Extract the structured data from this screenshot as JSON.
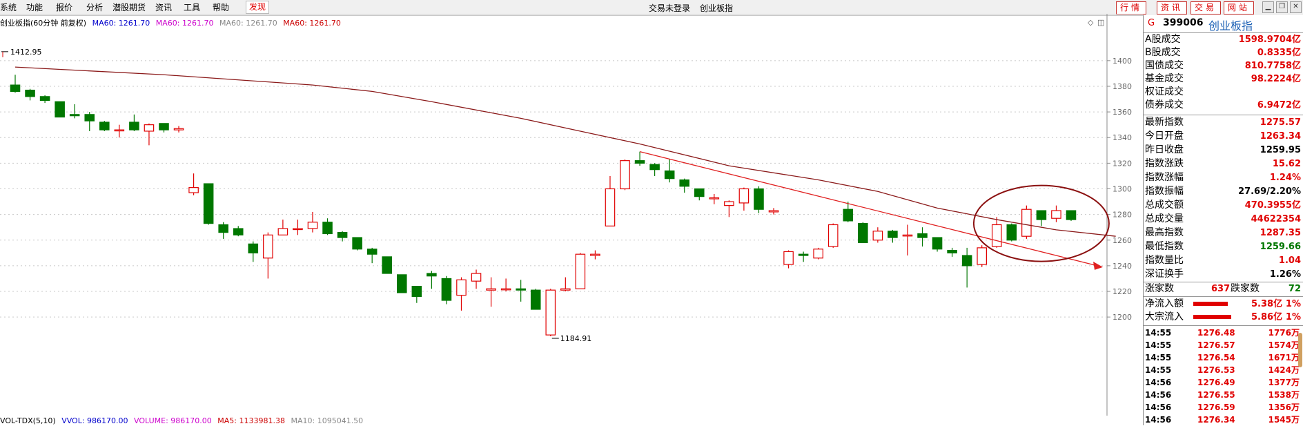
{
  "menu": {
    "items": [
      "系统",
      "功能",
      "报价",
      "分析",
      "潜股期货",
      "资讯",
      "工具",
      "帮助"
    ],
    "active": "发现",
    "center_login": "交易未登录",
    "center_index": "创业板指",
    "right_buttons": [
      "行情",
      "资讯",
      "交易",
      "网站"
    ]
  },
  "chart_header": {
    "title": "创业板指(60分钟 前复权)",
    "ma_labels": [
      "MA60: 1261.70",
      "MA60: 1261.70",
      "MA60: 1261.70",
      "MA60: 1261.70"
    ],
    "ma_colors": [
      "#0000cc",
      "#cc00cc",
      "#888888",
      "#cc0000"
    ]
  },
  "vol_header": {
    "items": [
      "VOL-TDX(5,10)",
      "VVOL: 986170.00",
      "VOLUME: 986170.00",
      "MA5: 1133981.38",
      "MA10: 1095041.50"
    ],
    "colors": [
      "#000000",
      "#0000cc",
      "#cc00cc",
      "#cc0000",
      "#888888"
    ]
  },
  "chart_data": {
    "type": "candlestick",
    "ylim": [
      1185,
      1415
    ],
    "y_ticks": [
      1200,
      1220,
      1240,
      1260,
      1280,
      1300,
      1320,
      1340,
      1360,
      1380,
      1400
    ],
    "high_label": "1412.95",
    "low_label": "1184.91",
    "up_color": "#e00000",
    "down_color": "#007700",
    "ma_color": "#8b1a1a",
    "candles": [
      {
        "o": 1381,
        "c": 1376,
        "h": 1389,
        "l": 1375
      },
      {
        "o": 1377,
        "c": 1372,
        "h": 1378,
        "l": 1369
      },
      {
        "o": 1372,
        "c": 1369,
        "h": 1373,
        "l": 1367
      },
      {
        "o": 1368,
        "c": 1356,
        "h": 1368,
        "l": 1356
      },
      {
        "o": 1358,
        "c": 1357,
        "h": 1366,
        "l": 1355
      },
      {
        "o": 1358,
        "c": 1353,
        "h": 1360,
        "l": 1345
      },
      {
        "o": 1352,
        "c": 1346,
        "h": 1353,
        "l": 1345
      },
      {
        "o": 1346,
        "c": 1346,
        "h": 1350,
        "l": 1340
      },
      {
        "o": 1352,
        "c": 1346,
        "h": 1358,
        "l": 1345
      },
      {
        "o": 1345,
        "c": 1350,
        "h": 1351,
        "l": 1334
      },
      {
        "o": 1351,
        "c": 1346,
        "h": 1351,
        "l": 1344
      },
      {
        "o": 1346,
        "c": 1347,
        "h": 1349,
        "l": 1344
      },
      {
        "o": 1297,
        "c": 1301,
        "h": 1312,
        "l": 1295
      },
      {
        "o": 1304,
        "c": 1273,
        "h": 1304,
        "l": 1272
      },
      {
        "o": 1272,
        "c": 1266,
        "h": 1274,
        "l": 1261
      },
      {
        "o": 1269,
        "c": 1264,
        "h": 1271,
        "l": 1263
      },
      {
        "o": 1257,
        "c": 1250,
        "h": 1259,
        "l": 1243
      },
      {
        "o": 1246,
        "c": 1264,
        "h": 1266,
        "l": 1230
      },
      {
        "o": 1264,
        "c": 1269,
        "h": 1276,
        "l": 1264
      },
      {
        "o": 1269,
        "c": 1269,
        "h": 1276,
        "l": 1264
      },
      {
        "o": 1269,
        "c": 1274,
        "h": 1282,
        "l": 1266
      },
      {
        "o": 1274,
        "c": 1265,
        "h": 1277,
        "l": 1264
      },
      {
        "o": 1266,
        "c": 1262,
        "h": 1267,
        "l": 1259
      },
      {
        "o": 1262,
        "c": 1253,
        "h": 1262,
        "l": 1252
      },
      {
        "o": 1253,
        "c": 1249,
        "h": 1254,
        "l": 1242
      },
      {
        "o": 1247,
        "c": 1234,
        "h": 1247,
        "l": 1234
      },
      {
        "o": 1233,
        "c": 1219,
        "h": 1233,
        "l": 1219
      },
      {
        "o": 1224,
        "c": 1216,
        "h": 1224,
        "l": 1211
      },
      {
        "o": 1234,
        "c": 1232,
        "h": 1236,
        "l": 1222
      },
      {
        "o": 1230,
        "c": 1213,
        "h": 1232,
        "l": 1210
      },
      {
        "o": 1217,
        "c": 1229,
        "h": 1231,
        "l": 1205
      },
      {
        "o": 1228,
        "c": 1234,
        "h": 1237,
        "l": 1222
      },
      {
        "o": 1221,
        "c": 1222,
        "h": 1231,
        "l": 1208
      },
      {
        "o": 1222,
        "c": 1222,
        "h": 1230,
        "l": 1220
      },
      {
        "o": 1222,
        "c": 1221,
        "h": 1229,
        "l": 1212
      },
      {
        "o": 1221,
        "c": 1206,
        "h": 1222,
        "l": 1206
      },
      {
        "o": 1186,
        "c": 1221,
        "h": 1222,
        "l": 1185
      },
      {
        "o": 1221,
        "c": 1222,
        "h": 1231,
        "l": 1220
      },
      {
        "o": 1222,
        "c": 1249,
        "h": 1250,
        "l": 1222
      },
      {
        "o": 1248,
        "c": 1249,
        "h": 1252,
        "l": 1245
      },
      {
        "o": 1271,
        "c": 1300,
        "h": 1310,
        "l": 1271
      },
      {
        "o": 1300,
        "c": 1322,
        "h": 1323,
        "l": 1299
      },
      {
        "o": 1322,
        "c": 1320,
        "h": 1329,
        "l": 1318
      },
      {
        "o": 1319,
        "c": 1315,
        "h": 1320,
        "l": 1310
      },
      {
        "o": 1314,
        "c": 1308,
        "h": 1323,
        "l": 1305
      },
      {
        "o": 1307,
        "c": 1302,
        "h": 1308,
        "l": 1297
      },
      {
        "o": 1300,
        "c": 1294,
        "h": 1300,
        "l": 1291
      },
      {
        "o": 1293,
        "c": 1293,
        "h": 1296,
        "l": 1288
      },
      {
        "o": 1287,
        "c": 1290,
        "h": 1291,
        "l": 1278
      },
      {
        "o": 1289,
        "c": 1300,
        "h": 1301,
        "l": 1283
      },
      {
        "o": 1300,
        "c": 1284,
        "h": 1302,
        "l": 1281
      },
      {
        "o": 1282,
        "c": 1283,
        "h": 1285,
        "l": 1280
      },
      {
        "o": 1241,
        "c": 1251,
        "h": 1252,
        "l": 1238
      },
      {
        "o": 1249,
        "c": 1248,
        "h": 1251,
        "l": 1243
      },
      {
        "o": 1246,
        "c": 1253,
        "h": 1254,
        "l": 1245
      },
      {
        "o": 1255,
        "c": 1272,
        "h": 1273,
        "l": 1254
      },
      {
        "o": 1284,
        "c": 1275,
        "h": 1290,
        "l": 1274
      },
      {
        "o": 1273,
        "c": 1258,
        "h": 1274,
        "l": 1258
      },
      {
        "o": 1260,
        "c": 1267,
        "h": 1270,
        "l": 1258
      },
      {
        "o": 1267,
        "c": 1262,
        "h": 1268,
        "l": 1258
      },
      {
        "o": 1264,
        "c": 1264,
        "h": 1272,
        "l": 1248
      },
      {
        "o": 1265,
        "c": 1262,
        "h": 1270,
        "l": 1255
      },
      {
        "o": 1262,
        "c": 1253,
        "h": 1262,
        "l": 1251
      },
      {
        "o": 1252,
        "c": 1250,
        "h": 1254,
        "l": 1247
      },
      {
        "o": 1248,
        "c": 1240,
        "h": 1254,
        "l": 1223
      },
      {
        "o": 1241,
        "c": 1254,
        "h": 1256,
        "l": 1239
      },
      {
        "o": 1255,
        "c": 1272,
        "h": 1278,
        "l": 1254
      },
      {
        "o": 1272,
        "c": 1260,
        "h": 1273,
        "l": 1259
      },
      {
        "o": 1263,
        "c": 1284,
        "h": 1287,
        "l": 1261
      },
      {
        "o": 1283,
        "c": 1276,
        "h": 1283,
        "l": 1271
      },
      {
        "o": 1277,
        "c": 1283,
        "h": 1287,
        "l": 1274
      },
      {
        "o": 1283,
        "c": 1276,
        "h": 1283,
        "l": 1275
      }
    ],
    "ma_line": [
      [
        0,
        1395
      ],
      [
        10,
        1389
      ],
      [
        20,
        1381
      ],
      [
        24,
        1376
      ],
      [
        28,
        1368
      ],
      [
        34,
        1355
      ],
      [
        38,
        1345
      ],
      [
        42,
        1335
      ],
      [
        48,
        1318
      ],
      [
        54,
        1307
      ],
      [
        58,
        1298
      ],
      [
        62,
        1285
      ],
      [
        66,
        1276
      ],
      [
        70,
        1268
      ],
      [
        74,
        1263
      ]
    ]
  },
  "right_panel": {
    "header_code": "399006",
    "header_name": "创业板指",
    "header_mark": "G",
    "rows_a": [
      {
        "label": "A股成交",
        "value": "1598.9704亿",
        "color": "#e00000"
      },
      {
        "label": "B股成交",
        "value": "0.8335亿",
        "color": "#e00000"
      },
      {
        "label": "国债成交",
        "value": "810.7758亿",
        "color": "#e00000"
      },
      {
        "label": "基金成交",
        "value": "98.2224亿",
        "color": "#e00000"
      },
      {
        "label": "权证成交",
        "value": "",
        "color": "#e00000"
      },
      {
        "label": "债券成交",
        "value": "6.9472亿",
        "color": "#e00000"
      }
    ],
    "rows_b": [
      {
        "label": "最新指数",
        "value": "1275.57",
        "color": "#e00000"
      },
      {
        "label": "今日开盘",
        "value": "1263.34",
        "color": "#e00000"
      },
      {
        "label": "昨日收盘",
        "value": "1259.95",
        "color": "#000000"
      },
      {
        "label": "指数涨跌",
        "value": "15.62",
        "color": "#e00000"
      },
      {
        "label": "指数涨幅",
        "value": "1.24%",
        "color": "#e00000"
      },
      {
        "label": "指数振幅",
        "value": "27.69/2.20%",
        "color": "#000000"
      },
      {
        "label": "总成交额",
        "value": "470.3955亿",
        "color": "#e00000"
      },
      {
        "label": "总成交量",
        "value": "44622354",
        "color": "#e00000"
      },
      {
        "label": "最高指数",
        "value": "1287.35",
        "color": "#e00000"
      },
      {
        "label": "最低指数",
        "value": "1259.66",
        "color": "#007700"
      },
      {
        "label": "指数量比",
        "value": "1.04",
        "color": "#e00000"
      },
      {
        "label": "深证换手",
        "value": "1.26%",
        "color": "#000000"
      }
    ],
    "up_count_label": "涨家数",
    "up_count": "637",
    "down_count_label": "跌家数",
    "down_count": "72",
    "flows": [
      {
        "label": "净流入额",
        "value": "5.38亿",
        "pct": "1%"
      },
      {
        "label": "大宗流入",
        "value": "5.86亿",
        "pct": "1%"
      }
    ],
    "ticks": [
      {
        "t": "14:55",
        "p": "1276.48",
        "v": "1776万"
      },
      {
        "t": "14:55",
        "p": "1276.57",
        "v": "1574万"
      },
      {
        "t": "14:55",
        "p": "1276.54",
        "v": "1671万"
      },
      {
        "t": "14:55",
        "p": "1276.53",
        "v": "1424万"
      },
      {
        "t": "14:56",
        "p": "1276.49",
        "v": "1377万"
      },
      {
        "t": "14:56",
        "p": "1276.55",
        "v": "1538万"
      },
      {
        "t": "14:56",
        "p": "1276.59",
        "v": "1356万"
      },
      {
        "t": "14:56",
        "p": "1276.34",
        "v": "1545万"
      }
    ]
  }
}
